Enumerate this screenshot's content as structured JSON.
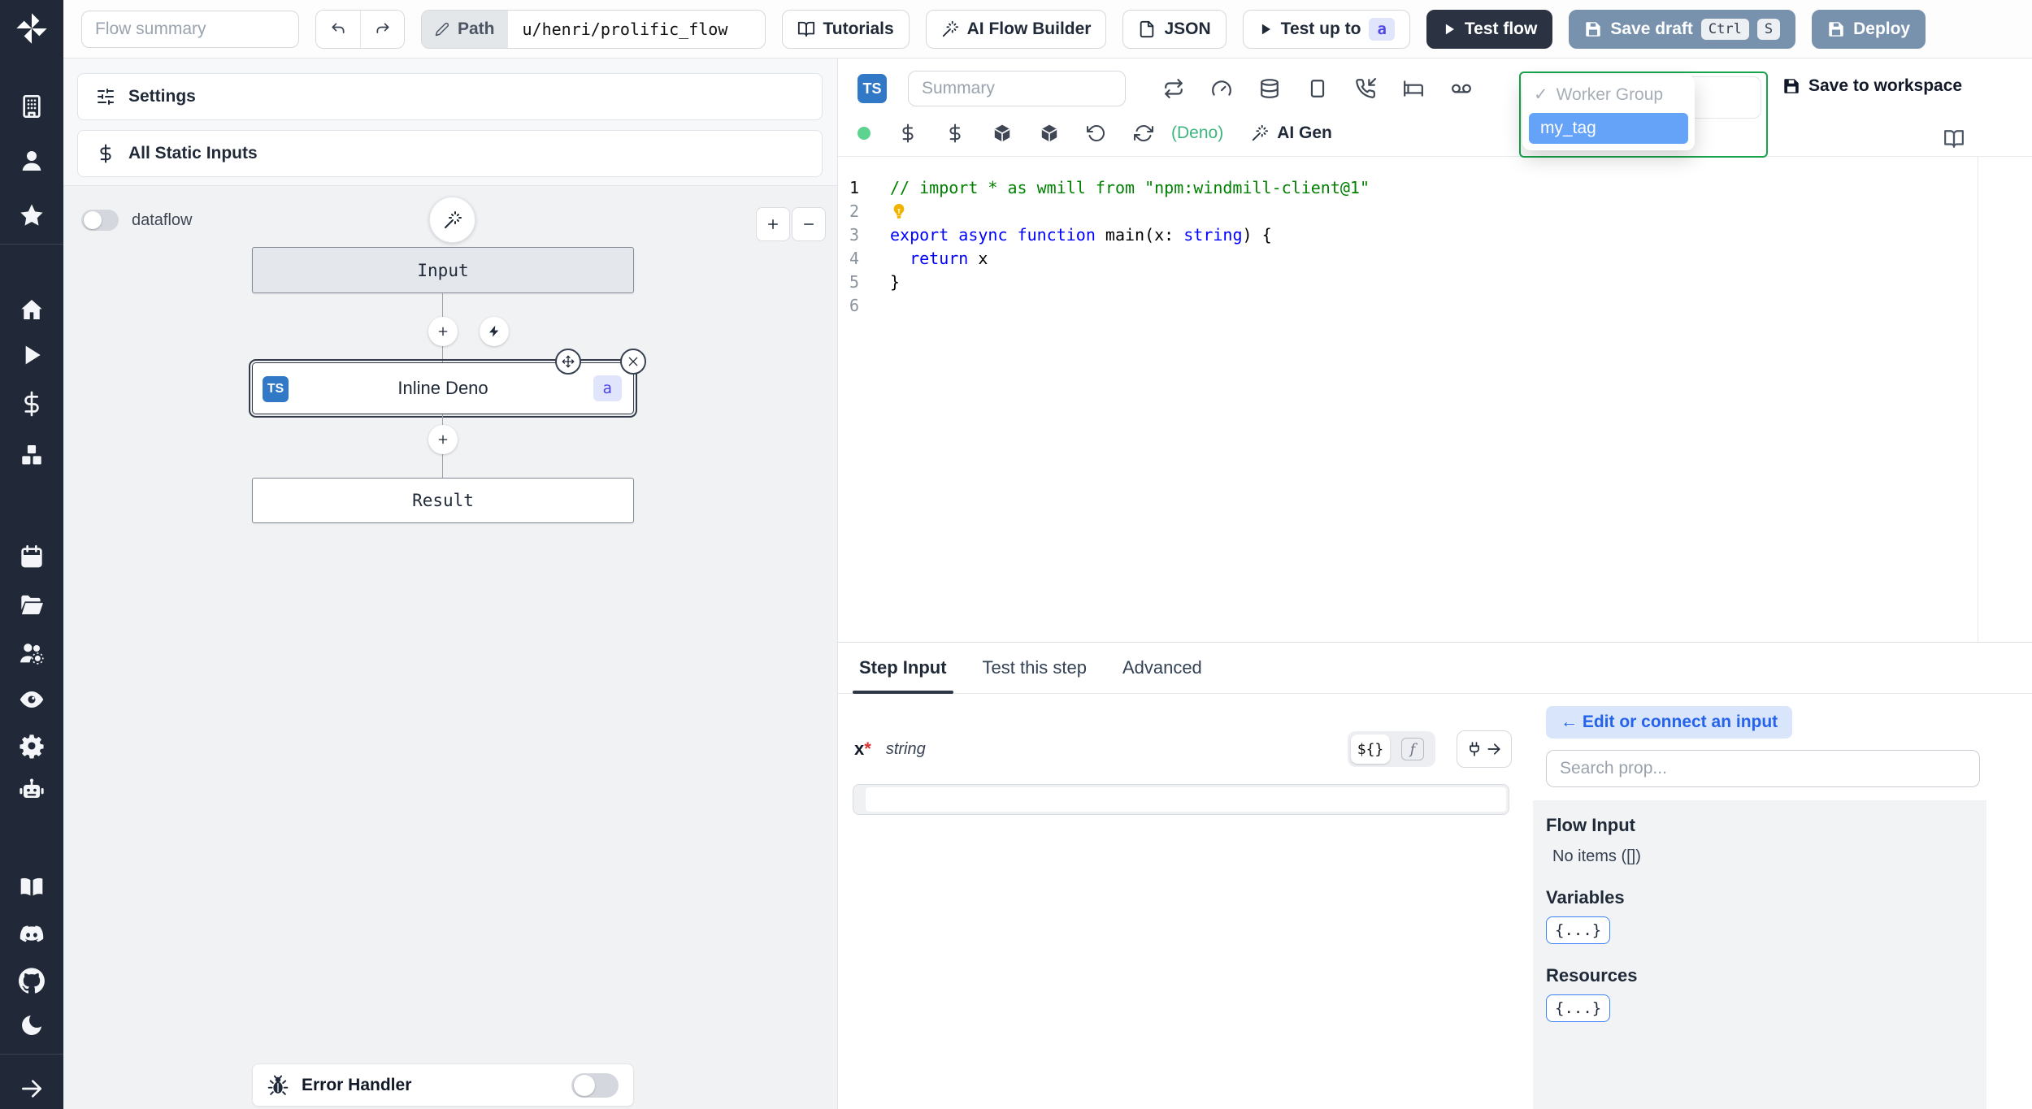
{
  "topbar": {
    "flow_summary_placeholder": "Flow summary",
    "path_label": "Path",
    "path_value": "u/henri/prolific_flow",
    "tutorials_label": "Tutorials",
    "ai_flow_builder_label": "AI Flow Builder",
    "json_label": "JSON",
    "test_up_to_label": "Test up to",
    "test_up_to_step": "a",
    "test_flow_label": "Test flow",
    "save_draft_label": "Save draft",
    "save_draft_kbd": [
      "Ctrl",
      "S"
    ],
    "deploy_label": "Deploy"
  },
  "sidebar": {
    "icons": [
      "building",
      "user",
      "star",
      "home",
      "play",
      "dollar",
      "cubes",
      "calendar",
      "folder-open",
      "users-gear",
      "eye",
      "gear",
      "robot",
      "book-open",
      "discord",
      "github",
      "moon",
      "arrow-right"
    ]
  },
  "flow_panel": {
    "settings_label": "Settings",
    "all_static_inputs_label": "All Static Inputs",
    "dataflow_label": "dataflow",
    "nodes": {
      "input_label": "Input",
      "step_label": "Inline Deno",
      "step_lang_badge": "TS",
      "step_id_badge": "a",
      "result_label": "Result"
    },
    "error_handler_label": "Error Handler"
  },
  "editor": {
    "lang_badge": "TS",
    "summary_placeholder": "Summary",
    "toolbar_icons": [
      "repeat",
      "gauge",
      "database",
      "square",
      "phone-incoming",
      "bed",
      "voicemail"
    ],
    "settings_icons": [
      "dollar",
      "dollar",
      "package",
      "package",
      "rotate-ccw",
      "refresh"
    ],
    "runtime_label": "(Deno)",
    "ai_gen_label": "AI Gen",
    "save_to_workspace_label": "Save to workspace",
    "worker_group_dropdown": {
      "check": "✓",
      "group_label": "Worker Group",
      "selected_tag": "my_tag"
    },
    "code": {
      "lines": [
        {
          "n": "1",
          "seg": [
            [
              "comment",
              "// import * as wmill from \"npm:windmill-client@1\""
            ]
          ]
        },
        {
          "n": "2",
          "seg": [
            [
              "bulb",
              ""
            ]
          ]
        },
        {
          "n": "3",
          "seg": [
            [
              "kw",
              "export"
            ],
            [
              "pl",
              " "
            ],
            [
              "kw",
              "async"
            ],
            [
              "pl",
              " "
            ],
            [
              "kw",
              "function"
            ],
            [
              "pl",
              " main(x: "
            ],
            [
              "kw",
              "string"
            ],
            [
              "pl",
              ") {"
            ]
          ]
        },
        {
          "n": "4",
          "seg": [
            [
              "pl",
              "  "
            ],
            [
              "kw",
              "return"
            ],
            [
              "pl",
              " x"
            ]
          ]
        },
        {
          "n": "5",
          "seg": [
            [
              "pl",
              "}"
            ]
          ]
        },
        {
          "n": "6",
          "seg": []
        }
      ]
    }
  },
  "bottom": {
    "tabs": [
      "Step Input",
      "Test this step",
      "Advanced"
    ],
    "active_tab": "Step Input",
    "field": {
      "name": "x",
      "required_mark": "*",
      "type": "string",
      "template_toggle": "${}",
      "js_toggle": "f"
    },
    "prop_picker": {
      "edit_connect_label": "← Edit or connect an input",
      "search_placeholder": "Search prop...",
      "flow_input_title": "Flow Input",
      "flow_input_empty": "No items ([])",
      "variables_title": "Variables",
      "resources_title": "Resources",
      "object_badge": "{...}"
    }
  },
  "colors": {
    "sidebar_bg": "#212837",
    "test_flow_bg": "#2b3342",
    "save_deploy_bg": "#7892ae",
    "ts_badge_bg": "#3178c6",
    "badge_indigo_bg": "#e0e5fc",
    "badge_indigo_text": "#4f46e5",
    "dropdown_border_green": "#18a44c",
    "selected_tag_bg": "#64a3f7",
    "deno_green": "#3db57e",
    "status_dot": "#5cd490",
    "code_comment": "#008000",
    "code_keyword": "#0000ff",
    "tab_underline": "#2f3747",
    "connect_pill_bg": "#d8e5fb",
    "connect_pill_text": "#2563eb",
    "object_badge_border": "#3b82f6"
  }
}
